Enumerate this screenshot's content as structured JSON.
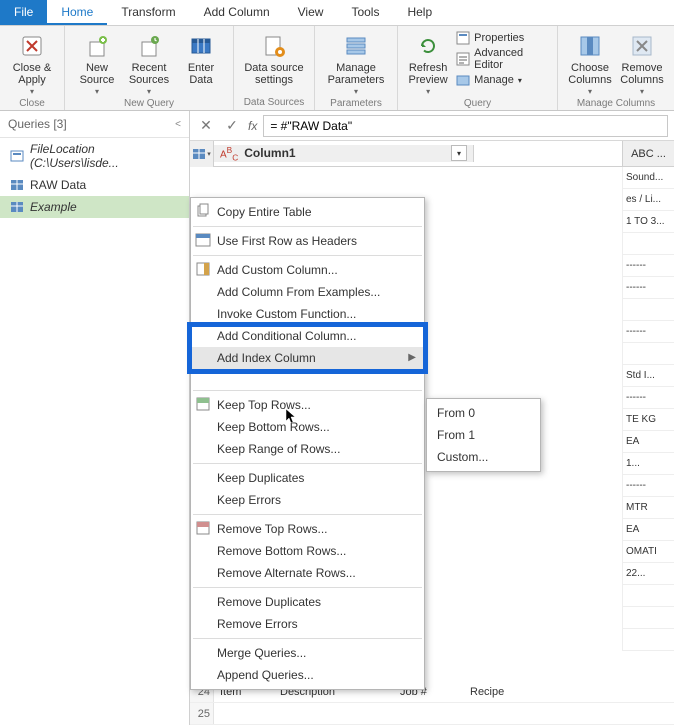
{
  "menu": {
    "file": "File",
    "home": "Home",
    "transform": "Transform",
    "addcol": "Add Column",
    "view": "View",
    "tools": "Tools",
    "help": "Help"
  },
  "ribbon": {
    "closeapply": "Close &\nApply",
    "newsource": "New\nSource",
    "recentsources": "Recent\nSources",
    "enterdata": "Enter\nData",
    "datasourcesettings": "Data source\nsettings",
    "manageparams": "Manage\nParameters",
    "refreshpreview": "Refresh\nPreview",
    "properties": "Properties",
    "adveditor": "Advanced Editor",
    "manage": "Manage",
    "choosecols": "Choose\nColumns",
    "removecols": "Remove\nColumns",
    "g_close": "Close",
    "g_newquery": "New Query",
    "g_datasources": "Data Sources",
    "g_parameters": "Parameters",
    "g_query": "Query",
    "g_managecols": "Manage Columns"
  },
  "queries": {
    "header": "Queries [3]",
    "items": [
      {
        "label": "FileLocation (C:\\Users\\lisde...",
        "type": "param"
      },
      {
        "label": "RAW Data",
        "type": "table"
      },
      {
        "label": "Example",
        "type": "table"
      }
    ]
  },
  "fx": {
    "label": "fx",
    "formula": "= #\"RAW Data\""
  },
  "grid": {
    "col_prefix": "A³C",
    "col1": "Column1",
    "frag_header": "ABC ...",
    "frag": [
      "Sound...",
      "es / Li...",
      "1 TO 3...",
      "",
      "------",
      "------",
      "",
      "------",
      "",
      "Std I...",
      "------",
      "TE KG",
      "EA",
      "1...",
      "------",
      "MTR",
      "EA",
      "OMATI",
      "22...",
      "",
      "",
      ""
    ]
  },
  "bottom_rows": {
    "n1": "24",
    "c1a": "Item",
    "c1b": "Description",
    "c1c": "Job #",
    "c1d": "Recipe",
    "n2": "25"
  },
  "ctx": {
    "copy": "Copy Entire Table",
    "firstrow": "Use First Row as Headers",
    "addcustom": "Add Custom Column...",
    "addexamples": "Add Column From Examples...",
    "invoke": "Invoke Custom Function...",
    "addcond": "Add Conditional Column...",
    "addindex": "Add Index Column",
    "choosecols_hidden": "",
    "keeptop": "Keep Top Rows...",
    "keepbottom": "Keep Bottom Rows...",
    "keeprange": "Keep Range of Rows...",
    "keepdup": "Keep Duplicates",
    "keeperr": "Keep Errors",
    "removetop": "Remove Top Rows...",
    "removebottom": "Remove Bottom Rows...",
    "removealt": "Remove Alternate Rows...",
    "removedup": "Remove Duplicates",
    "removeerr": "Remove Errors",
    "merge": "Merge Queries...",
    "append": "Append Queries..."
  },
  "submenu": {
    "from0": "From 0",
    "from1": "From 1",
    "custom": "Custom..."
  }
}
